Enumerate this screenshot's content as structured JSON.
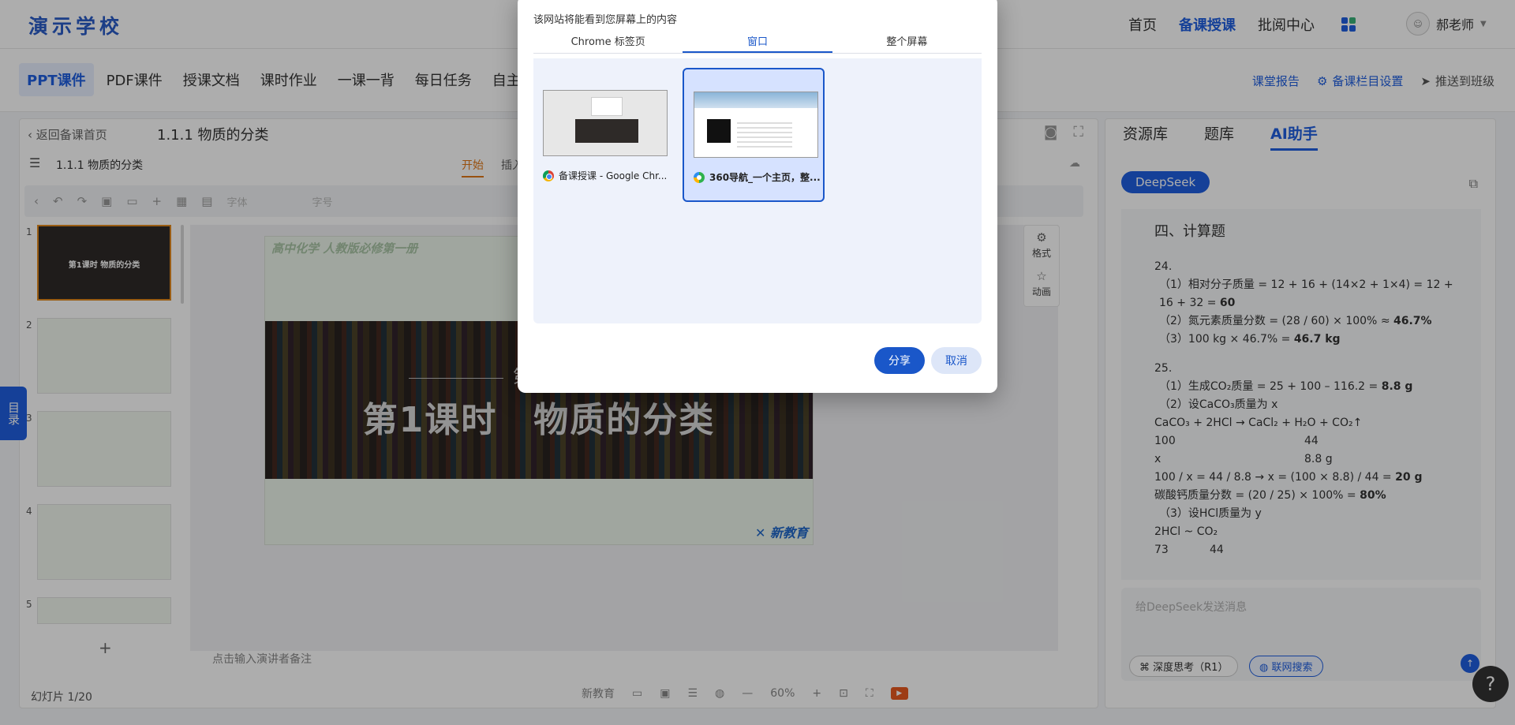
{
  "header": {
    "logo": "演示学校",
    "nav": [
      "首页",
      "备课授课",
      "批阅中心"
    ],
    "active_nav": "备课授课",
    "user_name": "郝老师"
  },
  "tab_bar": {
    "tabs": [
      "PPT课件",
      "PDF课件",
      "授课文档",
      "课时作业",
      "一课一背",
      "每日任务",
      "自主"
    ],
    "right_actions": {
      "report": "课堂报告",
      "settings": "备课栏目设置",
      "push": "推送到班级"
    }
  },
  "editor": {
    "back": "返回备课首页",
    "title": "1.1.1 物质的分类",
    "sub_title": "1.1.1 物质的分类",
    "menu_tabs": [
      "开始",
      "插入"
    ],
    "toolbar": {
      "font": "字体",
      "size": "字号"
    },
    "thumb_numbers": [
      "1",
      "2",
      "3",
      "4",
      "5"
    ],
    "thumb1_caption": "第1课时  物质的分类",
    "slide": {
      "top_text": "高中化学 人教版必修第一册",
      "section": "第一节",
      "main_title": "第1课时　物质的分类",
      "brand": "新教育"
    },
    "side_tools": [
      "格式",
      "动画"
    ],
    "notes_placeholder": "点击输入演讲者备注",
    "status": {
      "slide_count": "幻灯片 1/20",
      "mode": "新教育",
      "zoom": "60%"
    }
  },
  "toc_tab": "目录",
  "right_panel": {
    "tabs": [
      "资源库",
      "题库",
      "AI助手"
    ],
    "model": "DeepSeek",
    "chat": {
      "heading": "四、计算题",
      "q24": "24.",
      "q24_1a": "（1）相对分子质量 = 12 + 16 + (14×2 + 1×4) = 12 + 16 + 32 = ",
      "q24_1b": "60",
      "q24_2a": "（2）氮元素质量分数 = (28 / 60) × 100% ≈ ",
      "q24_2b": "46.7%",
      "q24_3a": "（3）100 kg × 46.7% = ",
      "q24_3b": "46.7 kg",
      "q25": "25.",
      "q25_1a": "（1）生成CO₂质量 = 25 + 100 – 116.2 = ",
      "q25_1b": "8.8 g",
      "q25_2": "（2）设CaCO₃质量为 x",
      "eq": "CaCO₃ + 2HCl → CaCl₂ + H₂O + CO₂↑",
      "r1a": "100",
      "r1b": "44",
      "r2a": "x",
      "r2b": "8.8 g",
      "calc_a": "100 / x = 44 / 8.8 → x = (100 × 8.8) / 44 = ",
      "calc_b": "20 g",
      "pct_a": "碳酸钙质量分数 = (20 / 25) × 100% = ",
      "pct_b": "80%",
      "q25_3": "（3）设HCl质量为 y",
      "hcl": "2HCl ~ CO₂",
      "r3a": "73",
      "r3b": "44"
    },
    "input_placeholder": "给DeepSeek发送消息",
    "chips": {
      "deep": "深度思考（R1）",
      "web": "联网搜索"
    }
  },
  "dialog": {
    "subtitle": "该网站将能看到您屏幕上的内容",
    "tabs": [
      "Chrome 标签页",
      "窗口",
      "整个屏幕"
    ],
    "active_tab": "窗口",
    "windows": [
      {
        "label": "备课授课 - Google Chr...",
        "icon": "chrome-icon"
      },
      {
        "label": "360导航_一个主页，整...",
        "icon": "browser-360-icon"
      }
    ],
    "share": "分享",
    "cancel": "取消"
  },
  "colors": {
    "primary": "#1f5fe0",
    "dialog_blue": "#1a57c9",
    "accent_orange": "#e07818"
  }
}
